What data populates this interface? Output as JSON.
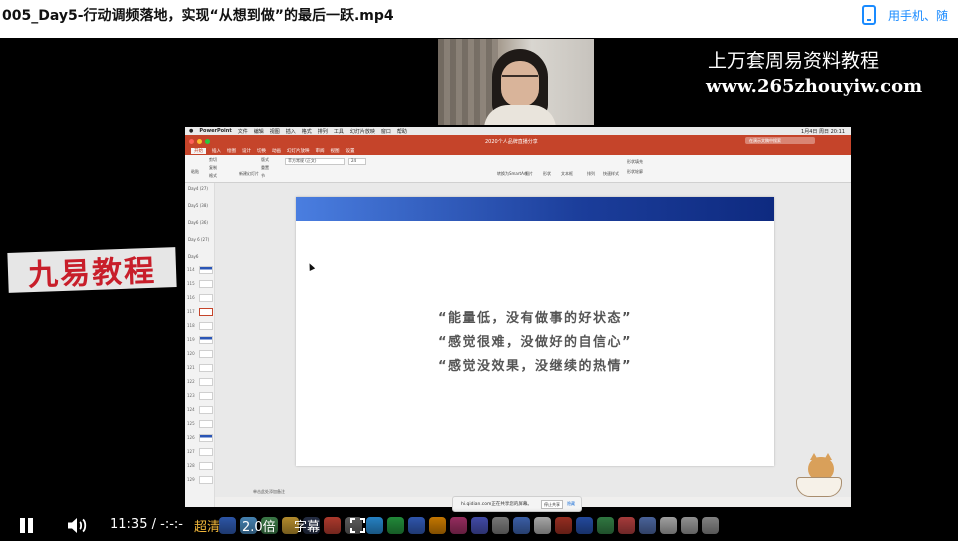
{
  "page": {
    "video_title": "005_Day5-行动调频落地，实现“从想到做”的最后一跃.mp4",
    "phone_link_label": "用手机、随"
  },
  "overlays": {
    "watermark_line1": "上万套周易资料教程",
    "watermark_line2": "www.265zhouyiw.com",
    "brand_stamp": "九易教程"
  },
  "ppt": {
    "app_name": "PowerPoint",
    "menu": [
      "文件",
      "编辑",
      "视图",
      "插入",
      "格式",
      "排列",
      "工具",
      "幻灯片放映",
      "窗口",
      "帮助"
    ],
    "document_name": "2020个人品牌直播分享",
    "clock": "1月4日 周日 20:11",
    "search_placeholder": "在演示文稿中搜索",
    "tabs": [
      "开始",
      "插入",
      "绘图",
      "设计",
      "切换",
      "动画",
      "幻灯片放映",
      "审阅",
      "视图",
      "设置"
    ],
    "active_tab": "开始",
    "ribbon": {
      "paste": "粘贴",
      "cut": "剪切",
      "copy": "复制",
      "format": "格式",
      "new_slide": "新建幻灯片",
      "layout": "版式",
      "reset": "重置",
      "section": "节",
      "font": "苹方常规 (正文)",
      "font_size": "24",
      "convert": "转换为SmartArt",
      "picture": "图片",
      "shape": "形状",
      "textbox": "文本框",
      "arrange": "排列",
      "quick_styles": "快速样式",
      "fill": "形状填充",
      "outline": "形状轮廓"
    },
    "sections": [
      "Day4 (27)",
      "Day5 (38)",
      "Day6 (36)",
      "Day 6 (27)",
      "Day6"
    ],
    "slide_numbers": [
      "114",
      "115",
      "116",
      "117",
      "118",
      "119",
      "120",
      "121",
      "122",
      "123",
      "124",
      "125",
      "126",
      "127",
      "128",
      "129"
    ],
    "quotes": [
      "“能量低，没有做事的好状态”",
      "“感觉很难，没做好的自信心”",
      "“感觉没效果，没继续的热情”"
    ],
    "notes_placeholder": "单击此处添加备注",
    "tooltip": {
      "text": "hi.qidian.com正在共享您的屏幕。",
      "stop_button": "停止共享",
      "hide_link": "隐藏"
    }
  },
  "controls": {
    "current_time": "11:35",
    "separator": "/",
    "duration": "-:-:-",
    "quality": "超清",
    "speed": "2.0倍",
    "subtitles": "字幕"
  },
  "icons": {
    "pause": "pause-icon",
    "volume": "volume-icon",
    "fullscreen": "fullscreen-icon",
    "phone": "phone-icon"
  },
  "colors": {
    "link_blue": "#1a8bff",
    "ppt_accent": "#c5442a",
    "stamp_red": "#c81e2a",
    "quality_orange": "#f0b63a",
    "slide_band": "#1b3d9a"
  }
}
